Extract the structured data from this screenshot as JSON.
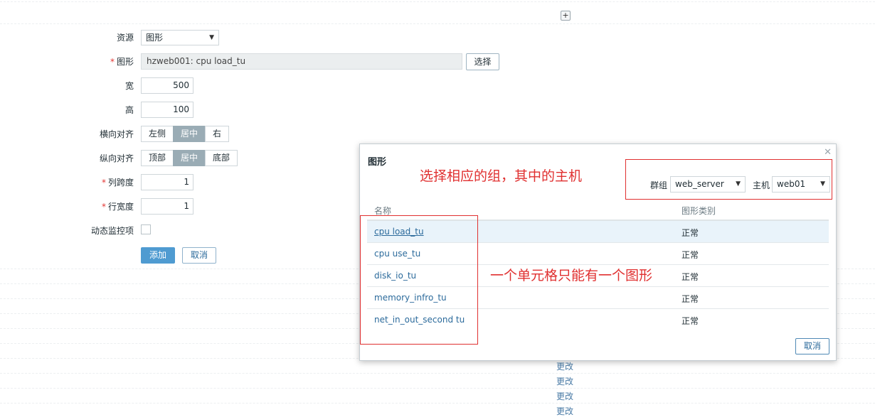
{
  "form": {
    "resource_label": "资源",
    "resource_value": "图形",
    "graph_label": "图形",
    "graph_value": "hzweb001: cpu load_tu",
    "select_button": "选择",
    "width_label": "宽",
    "width_value": "500",
    "height_label": "高",
    "height_value": "100",
    "halign_label": "横向对齐",
    "halign_options": [
      "左侧",
      "居中",
      "右"
    ],
    "valign_label": "纵向对齐",
    "valign_options": [
      "顶部",
      "居中",
      "底部"
    ],
    "colspan_label": "列跨度",
    "colspan_value": "1",
    "rowspan_label": "行宽度",
    "rowspan_value": "1",
    "dynamic_label": "动态监控项",
    "add_button": "添加",
    "cancel_button": "取消"
  },
  "change_links": [
    "更改",
    "更改",
    "更改",
    "更改"
  ],
  "modal": {
    "title": "图形",
    "group_label": "群组",
    "group_value": "web_server",
    "host_label": "主机",
    "host_value": "web01",
    "col_name": "名称",
    "col_type": "图形类别",
    "rows": [
      {
        "name": "cpu load_tu",
        "type": "正常"
      },
      {
        "name": "cpu use_tu",
        "type": "正常"
      },
      {
        "name": "disk_io_tu",
        "type": "正常"
      },
      {
        "name": "memory_infro_tu",
        "type": "正常"
      },
      {
        "name": "net_in_out_second tu",
        "type": "正常"
      }
    ],
    "cancel_button": "取消"
  },
  "annotations": {
    "top": "选择相应的组，其中的主机",
    "middle": "一个单元格只能有一个图形"
  },
  "colors": {
    "accent": "#4f9bd1",
    "annotation": "#e03030",
    "link": "#2b6a9b",
    "segment_active": "#9aacb5"
  }
}
